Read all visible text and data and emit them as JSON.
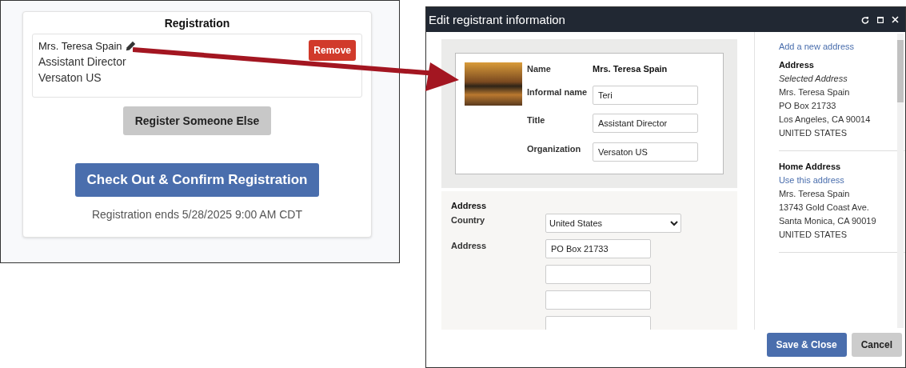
{
  "registration_panel": {
    "title": "Registration",
    "registrant": {
      "name": "Mrs. Teresa Spain",
      "title": "Assistant Director",
      "organization": "Versaton US"
    },
    "remove_button": "Remove",
    "register_other_button": "Register Someone Else",
    "checkout_button": "Check Out & Confirm Registration",
    "deadline": "Registration ends 5/28/2025 9:00 AM CDT"
  },
  "dialog": {
    "title": "Edit registrant information",
    "profile_fields": [
      {
        "label": "Name",
        "value": "Mrs. Teresa Spain",
        "kind": "static"
      },
      {
        "label": "Informal name",
        "value": "Teri",
        "kind": "input"
      },
      {
        "label": "Title",
        "value": "Assistant Director",
        "kind": "input"
      },
      {
        "label": "Organization",
        "value": "Versaton US",
        "kind": "input"
      }
    ],
    "address_form": {
      "heading": "Address",
      "country_label": "Country",
      "country": "United States",
      "address_label": "Address",
      "address_line_1": "PO Box 21733"
    },
    "sidebar": {
      "add_link": "Add a new address",
      "addresses": [
        {
          "heading": "Address",
          "note": "Selected Address",
          "lines": [
            "Mrs. Teresa Spain",
            "PO Box 21733",
            "Los Angeles, CA 90014",
            "UNITED STATES"
          ]
        },
        {
          "heading": "Home Address",
          "link": "Use this address",
          "lines": [
            "Mrs. Teresa Spain",
            "13743 Gold Coast Ave.",
            "Santa Monica, CA 90019",
            "UNITED STATES"
          ]
        }
      ]
    },
    "buttons": [
      {
        "label": "Save & Close",
        "kind": "primary"
      },
      {
        "label": "Cancel",
        "kind": "secondary"
      }
    ]
  }
}
